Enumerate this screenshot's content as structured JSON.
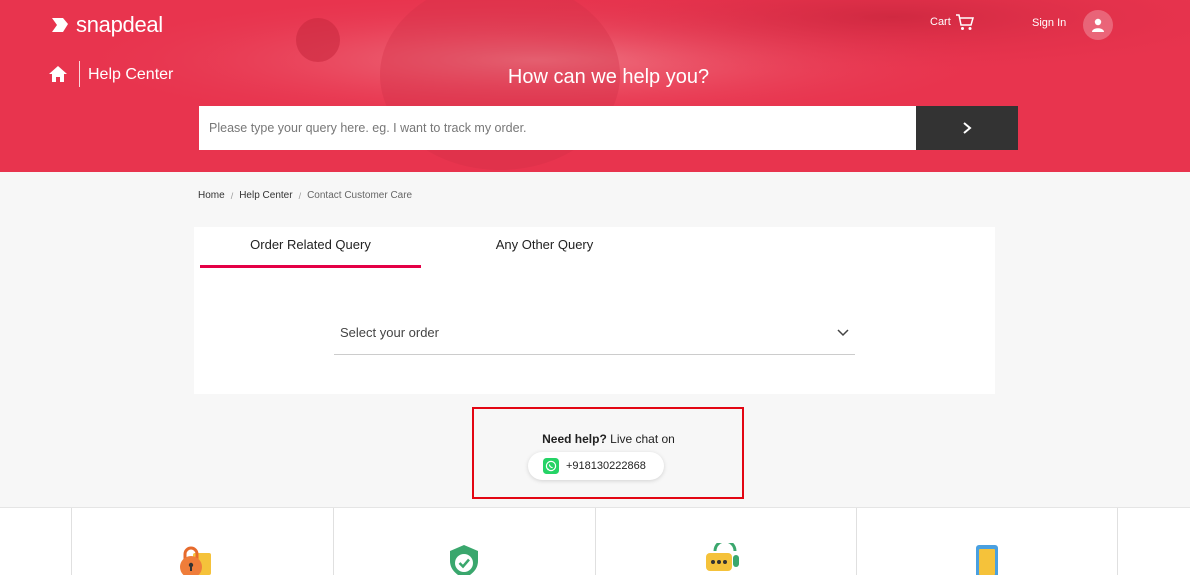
{
  "brand": {
    "name": "snapdeal",
    "accent": "#e40046",
    "hero_color": "#e8344e"
  },
  "header": {
    "cart_label": "Cart",
    "signin_label": "Sign In",
    "help_center_label": "Help Center",
    "heading": "How can we help you?"
  },
  "search": {
    "placeholder": "Please type your query here. eg. I want to track my order."
  },
  "breadcrumb": [
    "Home",
    "Help Center",
    "Contact Customer Care"
  ],
  "tabs": [
    {
      "label": "Order Related Query",
      "active": true
    },
    {
      "label": "Any Other Query",
      "active": false
    }
  ],
  "order_select": {
    "value": "Select your order"
  },
  "help": {
    "bold": "Need help?",
    "rest": " Live chat on",
    "whatsapp_number": "+918130222868"
  },
  "bottom_icons": [
    "lock-wallet-icon",
    "shield-check-icon",
    "chat-support-icon",
    "mobile-phone-icon"
  ]
}
